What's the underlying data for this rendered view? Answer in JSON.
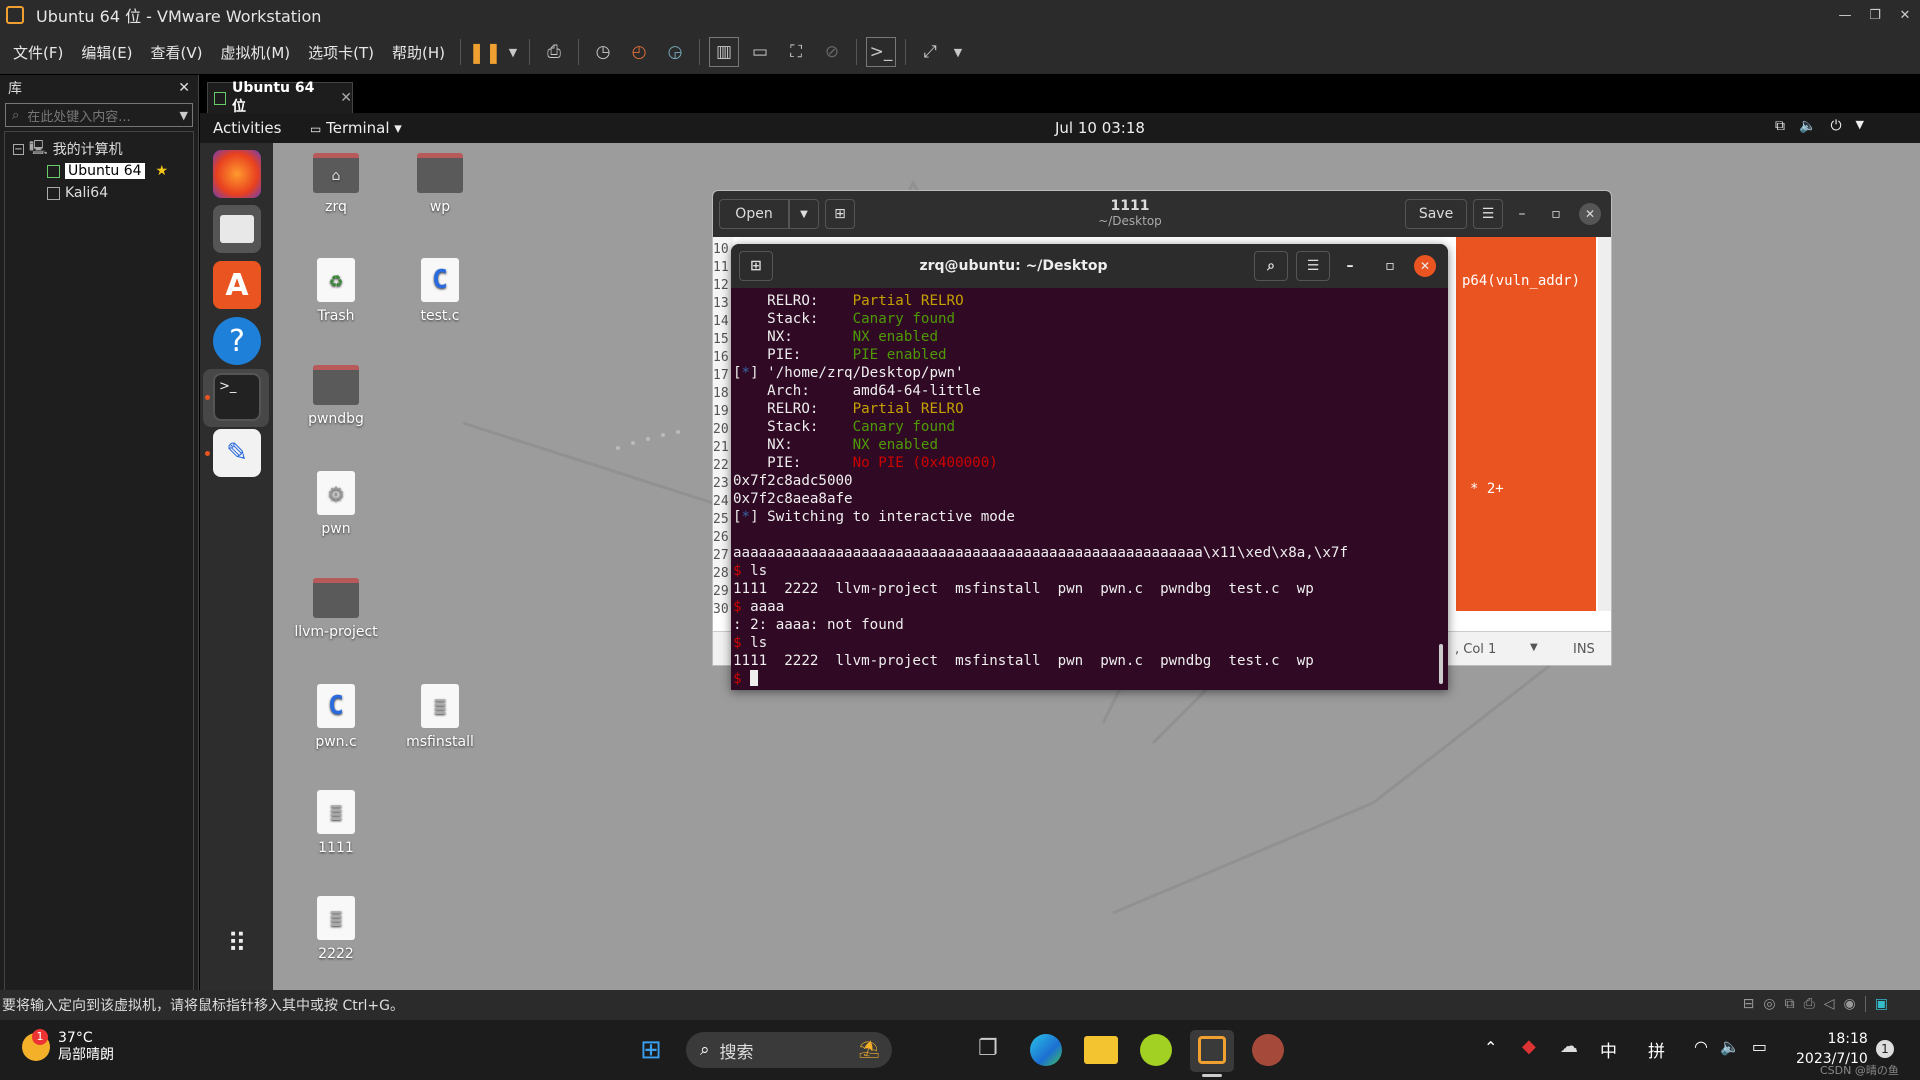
{
  "window": {
    "title": "Ubuntu 64 位 - VMware Workstation"
  },
  "menu": [
    "文件(F)",
    "编辑(E)",
    "查看(V)",
    "虚拟机(M)",
    "选项卡(T)",
    "帮助(H)"
  ],
  "library": {
    "title": "库",
    "search_placeholder": "在此处键入内容...",
    "tree": {
      "root": "我的计算机",
      "vms": [
        "Ubuntu 64",
        "Kali64"
      ]
    }
  },
  "vm_tab": {
    "label": "Ubuntu 64 位"
  },
  "guest_topbar": {
    "activities": "Activities",
    "app": "Terminal ▾",
    "clock": "Jul 10  03:18"
  },
  "desktop_icons": [
    {
      "label": "zrq"
    },
    {
      "label": "wp"
    },
    {
      "label": "Trash"
    },
    {
      "label": "test.c"
    },
    {
      "label": "pwndbg"
    },
    {
      "label": "pwn"
    },
    {
      "label": "llvm-project"
    },
    {
      "label": "pwn.c"
    },
    {
      "label": "msfinstall"
    },
    {
      "label": "1111"
    },
    {
      "label": "2222"
    }
  ],
  "gedit": {
    "open": "Open",
    "title": "1111",
    "subtitle": "~/Desktop",
    "save": "Save",
    "line_numbers": [
      "10",
      "11",
      "12",
      "13",
      "14",
      "15",
      "16",
      "17",
      "18",
      "19",
      "20",
      "21",
      "22",
      "23",
      "24",
      "25",
      "26",
      "27",
      "28",
      "29",
      "30"
    ],
    "fragment_right": "p64(vuln_addr)",
    "fragment_right2": "* 2+",
    "statusbar": {
      "pos": ", Col 1",
      "mode": "INS"
    }
  },
  "terminal": {
    "title": "zrq@ubuntu: ~/Desktop",
    "lines": [
      {
        "k": "    RELRO:    ",
        "v": "Partial RELRO",
        "c": "y"
      },
      {
        "k": "    Stack:    ",
        "v": "Canary found",
        "c": "g"
      },
      {
        "k": "    NX:       ",
        "v": "NX enabled",
        "c": "g"
      },
      {
        "k": "    PIE:      ",
        "v": "PIE enabled",
        "c": "g"
      },
      {
        "k": "[*] '/home/zrq/Desktop/pwn'",
        "v": "",
        "c": ""
      },
      {
        "k": "    Arch:     ",
        "v": "amd64-64-little",
        "c": ""
      },
      {
        "k": "    RELRO:    ",
        "v": "Partial RELRO",
        "c": "y"
      },
      {
        "k": "    Stack:    ",
        "v": "Canary found",
        "c": "g"
      },
      {
        "k": "    NX:       ",
        "v": "NX enabled",
        "c": "g"
      },
      {
        "k": "    PIE:      ",
        "v": "No PIE (0x400000)",
        "c": "r"
      },
      {
        "k": "0x7f2c8adc5000",
        "v": "",
        "c": ""
      },
      {
        "k": "0x7f2c8aea8afe",
        "v": "",
        "c": ""
      },
      {
        "k": "[*] Switching to interactive mode",
        "v": "",
        "c": ""
      },
      {
        "k": "",
        "v": "",
        "c": ""
      },
      {
        "k": "aaaaaaaaaaaaaaaaaaaaaaaaaaaaaaaaaaaaaaaaaaaaaaaaaaaaaaa\\x11\\xed\\x8a,\\x7f",
        "v": "",
        "c": ""
      },
      {
        "k": "$ ls",
        "v": "",
        "c": ""
      },
      {
        "k": "1111  2222  llvm-project  msfinstall  pwn  pwn.c  pwndbg  test.c  wp",
        "v": "",
        "c": ""
      },
      {
        "k": "$ aaaa",
        "v": "",
        "c": ""
      },
      {
        "k": ": 2: aaaa: not found",
        "v": "",
        "c": ""
      },
      {
        "k": "$ ls",
        "v": "",
        "c": ""
      },
      {
        "k": "1111  2222  llvm-project  msfinstall  pwn  pwn.c  pwndbg  test.c  wp",
        "v": "",
        "c": ""
      },
      {
        "k": "$ ",
        "v": "",
        "c": ""
      }
    ]
  },
  "statusbar": {
    "text": "要将输入定向到该虚拟机，请将鼠标指针移入其中或按 Ctrl+G。"
  },
  "taskbar": {
    "weather": {
      "temp": "37°C",
      "desc": "局部晴朗",
      "badge": "1"
    },
    "search": "搜索",
    "ime1": "中",
    "ime2": "拼",
    "time": "18:18",
    "date": "2023/7/10",
    "notif": "1",
    "watermark": "CSDN @晴の鱼"
  }
}
